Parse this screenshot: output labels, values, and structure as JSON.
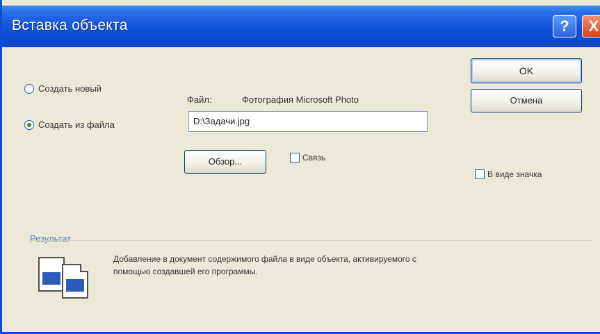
{
  "window": {
    "title": "Вставка объекта",
    "help_label": "?",
    "close_label": "X"
  },
  "options": {
    "create_new": "Создать новый",
    "create_from_file": "Создать из файла",
    "selected": "create_from_file"
  },
  "file": {
    "label": "Файл:",
    "type": "Фотография Microsoft Photo",
    "path": "D:\\Задачи.jpg"
  },
  "buttons": {
    "ok": "OK",
    "cancel": "Отмена",
    "browse": "Обзор..."
  },
  "checkboxes": {
    "link": "Связь",
    "link_checked": false,
    "as_icon": "В виде значка",
    "as_icon_checked": false
  },
  "result": {
    "label": "Результат",
    "text": "Добавление в документ содержимого файла в виде объекта, активируемого с помощью создавшей его программы."
  }
}
